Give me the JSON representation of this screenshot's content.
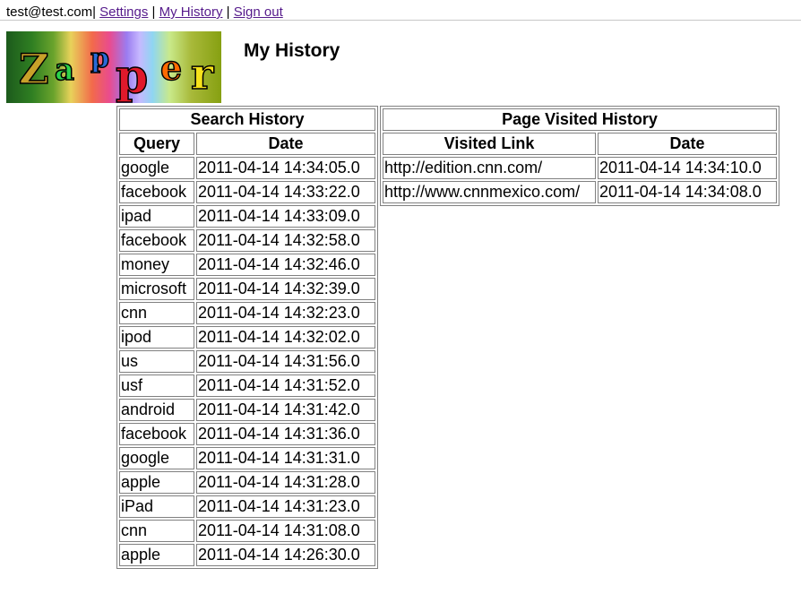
{
  "topbar": {
    "user_email": "test@test.com",
    "links": [
      "Settings",
      "My History",
      "Sign out"
    ]
  },
  "logo": {
    "letters": [
      "Z",
      "a",
      "p",
      "p",
      "e",
      "r"
    ],
    "letter_colors": [
      "#c8a12a",
      "#2bd24a",
      "#2a6ad8",
      "#e0192b",
      "#ff6a00",
      "#f7e21a"
    ]
  },
  "page_title": "My History",
  "search_history": {
    "title": "Search History",
    "headers": [
      "Query",
      "Date"
    ],
    "rows": [
      [
        "google",
        "2011-04-14 14:34:05.0"
      ],
      [
        "facebook",
        "2011-04-14 14:33:22.0"
      ],
      [
        "ipad",
        "2011-04-14 14:33:09.0"
      ],
      [
        "facebook",
        "2011-04-14 14:32:58.0"
      ],
      [
        "money",
        "2011-04-14 14:32:46.0"
      ],
      [
        "microsoft",
        "2011-04-14 14:32:39.0"
      ],
      [
        "cnn",
        "2011-04-14 14:32:23.0"
      ],
      [
        "ipod",
        "2011-04-14 14:32:02.0"
      ],
      [
        "us",
        "2011-04-14 14:31:56.0"
      ],
      [
        "usf",
        "2011-04-14 14:31:52.0"
      ],
      [
        "android",
        "2011-04-14 14:31:42.0"
      ],
      [
        "facebook",
        "2011-04-14 14:31:36.0"
      ],
      [
        "google",
        "2011-04-14 14:31:31.0"
      ],
      [
        "apple",
        "2011-04-14 14:31:28.0"
      ],
      [
        "iPad",
        "2011-04-14 14:31:23.0"
      ],
      [
        "cnn",
        "2011-04-14 14:31:08.0"
      ],
      [
        "apple",
        "2011-04-14 14:26:30.0"
      ]
    ]
  },
  "page_visited_history": {
    "title": "Page Visited History",
    "headers": [
      "Visited Link",
      "Date"
    ],
    "rows": [
      [
        "http://edition.cnn.com/",
        "2011-04-14 14:34:10.0"
      ],
      [
        "http://www.cnnmexico.com/",
        "2011-04-14 14:34:08.0"
      ]
    ]
  },
  "colors": {
    "visited_link": "#551a8b",
    "table_border": "#808080"
  }
}
